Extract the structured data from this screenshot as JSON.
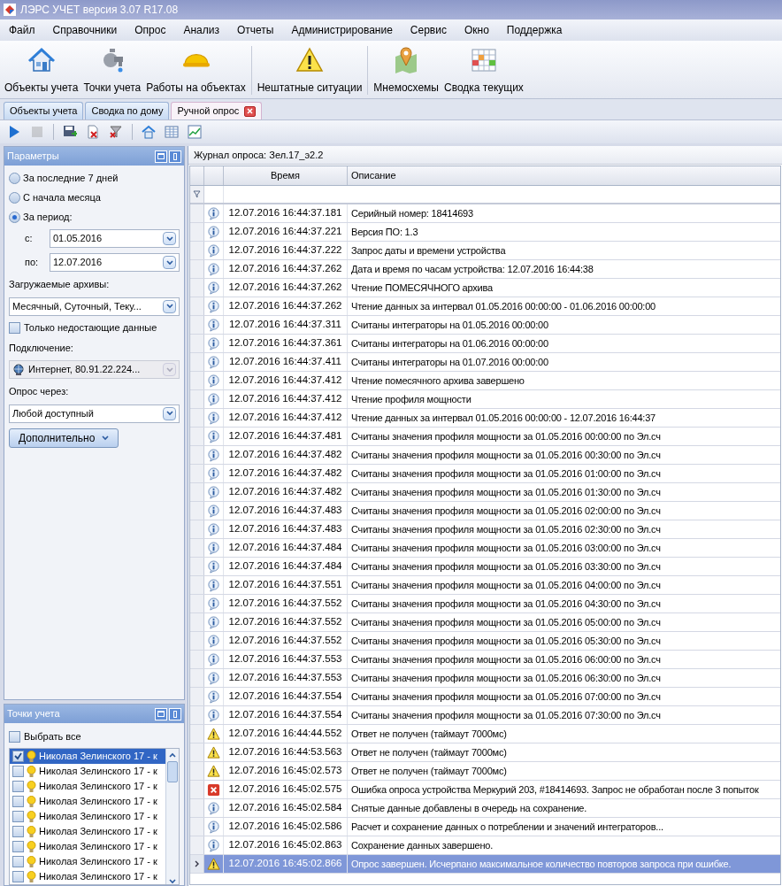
{
  "window": {
    "title": "ЛЭРС УЧЕТ версия 3.07 R17.08"
  },
  "menu": [
    "Файл",
    "Справочники",
    "Опрос",
    "Анализ",
    "Отчеты",
    "Администрирование",
    "Сервис",
    "Окно",
    "Поддержка"
  ],
  "ribbon": [
    {
      "kind": "house",
      "label": "Объекты учета"
    },
    {
      "kind": "faucet",
      "label": "Точки учета"
    },
    {
      "kind": "helmet",
      "label": "Работы на объектах"
    },
    {
      "kind": "warning",
      "label": "Нештатные ситуации"
    },
    {
      "kind": "pin",
      "label": "Мнемосхемы"
    },
    {
      "kind": "grid",
      "label": "Сводка текущих"
    }
  ],
  "tabs": [
    {
      "label": "Объекты учета",
      "selected": false
    },
    {
      "label": "Сводка по дому",
      "selected": false
    },
    {
      "label": "Ручной опрос",
      "selected": true
    }
  ],
  "toolbar": [
    {
      "kind": "play",
      "disabled": false
    },
    {
      "kind": "stop",
      "disabled": true
    },
    {
      "kind": "save",
      "disabled": false
    },
    {
      "kind": "delete",
      "disabled": false
    },
    {
      "kind": "clear-filter",
      "disabled": false
    },
    {
      "kind": "home",
      "disabled": false
    },
    {
      "kind": "table",
      "disabled": false
    },
    {
      "kind": "chart",
      "disabled": false
    }
  ],
  "parameters": {
    "title": "Параметры",
    "periods": [
      {
        "label": "За последние 7 дней",
        "selected": false
      },
      {
        "label": "С начала месяца",
        "selected": false
      },
      {
        "label": "За период:",
        "selected": true
      }
    ],
    "from": {
      "label": "с:",
      "value": "01.05.2016"
    },
    "to": {
      "label": "по:",
      "value": "12.07.2016"
    },
    "archives": {
      "label": "Загружаемые архивы:",
      "value": "Месячный, Суточный, Теку..."
    },
    "only_missing": {
      "label": "Только недостающие данные",
      "checked": false
    },
    "connection": {
      "label": "Подключение:",
      "value": "Интернет, 80.91.22.224...",
      "disabled": true
    },
    "poll_via": {
      "label": "Опрос через:",
      "value": "Любой доступный"
    },
    "more_button": "Дополнительно"
  },
  "points": {
    "title": "Точки учета",
    "select_all": {
      "label": "Выбрать все",
      "checked": false
    },
    "items": [
      {
        "label": "Николая Зелинского 17 - к",
        "checked": true,
        "selected": true
      },
      {
        "label": "Николая Зелинского 17 - к",
        "checked": false,
        "selected": false
      },
      {
        "label": "Николая Зелинского 17 - к",
        "checked": false,
        "selected": false
      },
      {
        "label": "Николая Зелинского 17 - к",
        "checked": false,
        "selected": false
      },
      {
        "label": "Николая Зелинского 17 - к",
        "checked": false,
        "selected": false
      },
      {
        "label": "Николая Зелинского 17 - к",
        "checked": false,
        "selected": false
      },
      {
        "label": "Николая Зелинского 17 - к",
        "checked": false,
        "selected": false
      },
      {
        "label": "Николая Зелинского 17 - к",
        "checked": false,
        "selected": false
      },
      {
        "label": "Николая Зелинского 17 - к",
        "checked": false,
        "selected": false
      }
    ]
  },
  "log": {
    "title": "Журнал опроса: Зел.17_э2.2",
    "columns": [
      "Время",
      "Описание"
    ],
    "rows": [
      {
        "kind": "info",
        "time": "12.07.2016 16:44:37.181",
        "text": "Серийный номер: 18414693",
        "selected": false
      },
      {
        "kind": "info",
        "time": "12.07.2016 16:44:37.221",
        "text": "Версия ПО: 1.3",
        "selected": false
      },
      {
        "kind": "info",
        "time": "12.07.2016 16:44:37.222",
        "text": "Запрос даты и времени устройства",
        "selected": false
      },
      {
        "kind": "info",
        "time": "12.07.2016 16:44:37.262",
        "text": "Дата и время по часам устройства: 12.07.2016 16:44:38",
        "selected": false
      },
      {
        "kind": "info",
        "time": "12.07.2016 16:44:37.262",
        "text": "Чтение ПОМЕСЯЧНОГО архива",
        "selected": false
      },
      {
        "kind": "info",
        "time": "12.07.2016 16:44:37.262",
        "text": "Чтение данных за интервал 01.05.2016 00:00:00 - 01.06.2016 00:00:00",
        "selected": false
      },
      {
        "kind": "info",
        "time": "12.07.2016 16:44:37.311",
        "text": "Считаны интеграторы на 01.05.2016 00:00:00",
        "selected": false
      },
      {
        "kind": "info",
        "time": "12.07.2016 16:44:37.361",
        "text": "Считаны интеграторы на 01.06.2016 00:00:00",
        "selected": false
      },
      {
        "kind": "info",
        "time": "12.07.2016 16:44:37.411",
        "text": "Считаны интеграторы на 01.07.2016 00:00:00",
        "selected": false
      },
      {
        "kind": "info",
        "time": "12.07.2016 16:44:37.412",
        "text": "Чтение помесячного архива завершено",
        "selected": false
      },
      {
        "kind": "info",
        "time": "12.07.2016 16:44:37.412",
        "text": "Чтение профиля мощности",
        "selected": false
      },
      {
        "kind": "info",
        "time": "12.07.2016 16:44:37.412",
        "text": "Чтение данных за интервал 01.05.2016 00:00:00 - 12.07.2016 16:44:37",
        "selected": false
      },
      {
        "kind": "info",
        "time": "12.07.2016 16:44:37.481",
        "text": "Считаны значения профиля мощности за 01.05.2016 00:00:00 по Эл.сч",
        "selected": false
      },
      {
        "kind": "info",
        "time": "12.07.2016 16:44:37.482",
        "text": "Считаны значения профиля мощности за 01.05.2016 00:30:00 по Эл.сч",
        "selected": false
      },
      {
        "kind": "info",
        "time": "12.07.2016 16:44:37.482",
        "text": "Считаны значения профиля мощности за 01.05.2016 01:00:00 по Эл.сч",
        "selected": false
      },
      {
        "kind": "info",
        "time": "12.07.2016 16:44:37.482",
        "text": "Считаны значения профиля мощности за 01.05.2016 01:30:00 по Эл.сч",
        "selected": false
      },
      {
        "kind": "info",
        "time": "12.07.2016 16:44:37.483",
        "text": "Считаны значения профиля мощности за 01.05.2016 02:00:00 по Эл.сч",
        "selected": false
      },
      {
        "kind": "info",
        "time": "12.07.2016 16:44:37.483",
        "text": "Считаны значения профиля мощности за 01.05.2016 02:30:00 по Эл.сч",
        "selected": false
      },
      {
        "kind": "info",
        "time": "12.07.2016 16:44:37.484",
        "text": "Считаны значения профиля мощности за 01.05.2016 03:00:00 по Эл.сч",
        "selected": false
      },
      {
        "kind": "info",
        "time": "12.07.2016 16:44:37.484",
        "text": "Считаны значения профиля мощности за 01.05.2016 03:30:00 по Эл.сч",
        "selected": false
      },
      {
        "kind": "info",
        "time": "12.07.2016 16:44:37.551",
        "text": "Считаны значения профиля мощности за 01.05.2016 04:00:00 по Эл.сч",
        "selected": false
      },
      {
        "kind": "info",
        "time": "12.07.2016 16:44:37.552",
        "text": "Считаны значения профиля мощности за 01.05.2016 04:30:00 по Эл.сч",
        "selected": false
      },
      {
        "kind": "info",
        "time": "12.07.2016 16:44:37.552",
        "text": "Считаны значения профиля мощности за 01.05.2016 05:00:00 по Эл.сч",
        "selected": false
      },
      {
        "kind": "info",
        "time": "12.07.2016 16:44:37.552",
        "text": "Считаны значения профиля мощности за 01.05.2016 05:30:00 по Эл.сч",
        "selected": false
      },
      {
        "kind": "info",
        "time": "12.07.2016 16:44:37.553",
        "text": "Считаны значения профиля мощности за 01.05.2016 06:00:00 по Эл.сч",
        "selected": false
      },
      {
        "kind": "info",
        "time": "12.07.2016 16:44:37.553",
        "text": "Считаны значения профиля мощности за 01.05.2016 06:30:00 по Эл.сч",
        "selected": false
      },
      {
        "kind": "info",
        "time": "12.07.2016 16:44:37.554",
        "text": "Считаны значения профиля мощности за 01.05.2016 07:00:00 по Эл.сч",
        "selected": false
      },
      {
        "kind": "info",
        "time": "12.07.2016 16:44:37.554",
        "text": "Считаны значения профиля мощности за 01.05.2016 07:30:00 по Эл.сч",
        "selected": false
      },
      {
        "kind": "warning",
        "time": "12.07.2016 16:44:44.552",
        "text": "Ответ не получен (таймаут 7000мс)",
        "selected": false
      },
      {
        "kind": "warning",
        "time": "12.07.2016 16:44:53.563",
        "text": "Ответ не получен (таймаут 7000мс)",
        "selected": false
      },
      {
        "kind": "warning",
        "time": "12.07.2016 16:45:02.573",
        "text": "Ответ не получен (таймаут 7000мс)",
        "selected": false
      },
      {
        "kind": "error",
        "time": "12.07.2016 16:45:02.575",
        "text": "Ошибка опроса устройства Меркурий 203, #18414693. Запрос не обработан после 3 попыток",
        "selected": false
      },
      {
        "kind": "info",
        "time": "12.07.2016 16:45:02.584",
        "text": "Снятые данные добавлены в очередь на сохранение.",
        "selected": false
      },
      {
        "kind": "info",
        "time": "12.07.2016 16:45:02.586",
        "text": "Расчет и сохранение данных о потреблении и значений интеграторов...",
        "selected": false
      },
      {
        "kind": "info",
        "time": "12.07.2016 16:45:02.863",
        "text": "Сохранение данных завершено.",
        "selected": false
      },
      {
        "kind": "warning",
        "time": "12.07.2016 16:45:02.866",
        "text": "Опрос завершен. Исчерпано максимальное количество повторов запроса при ошибке.",
        "selected": true
      }
    ]
  }
}
